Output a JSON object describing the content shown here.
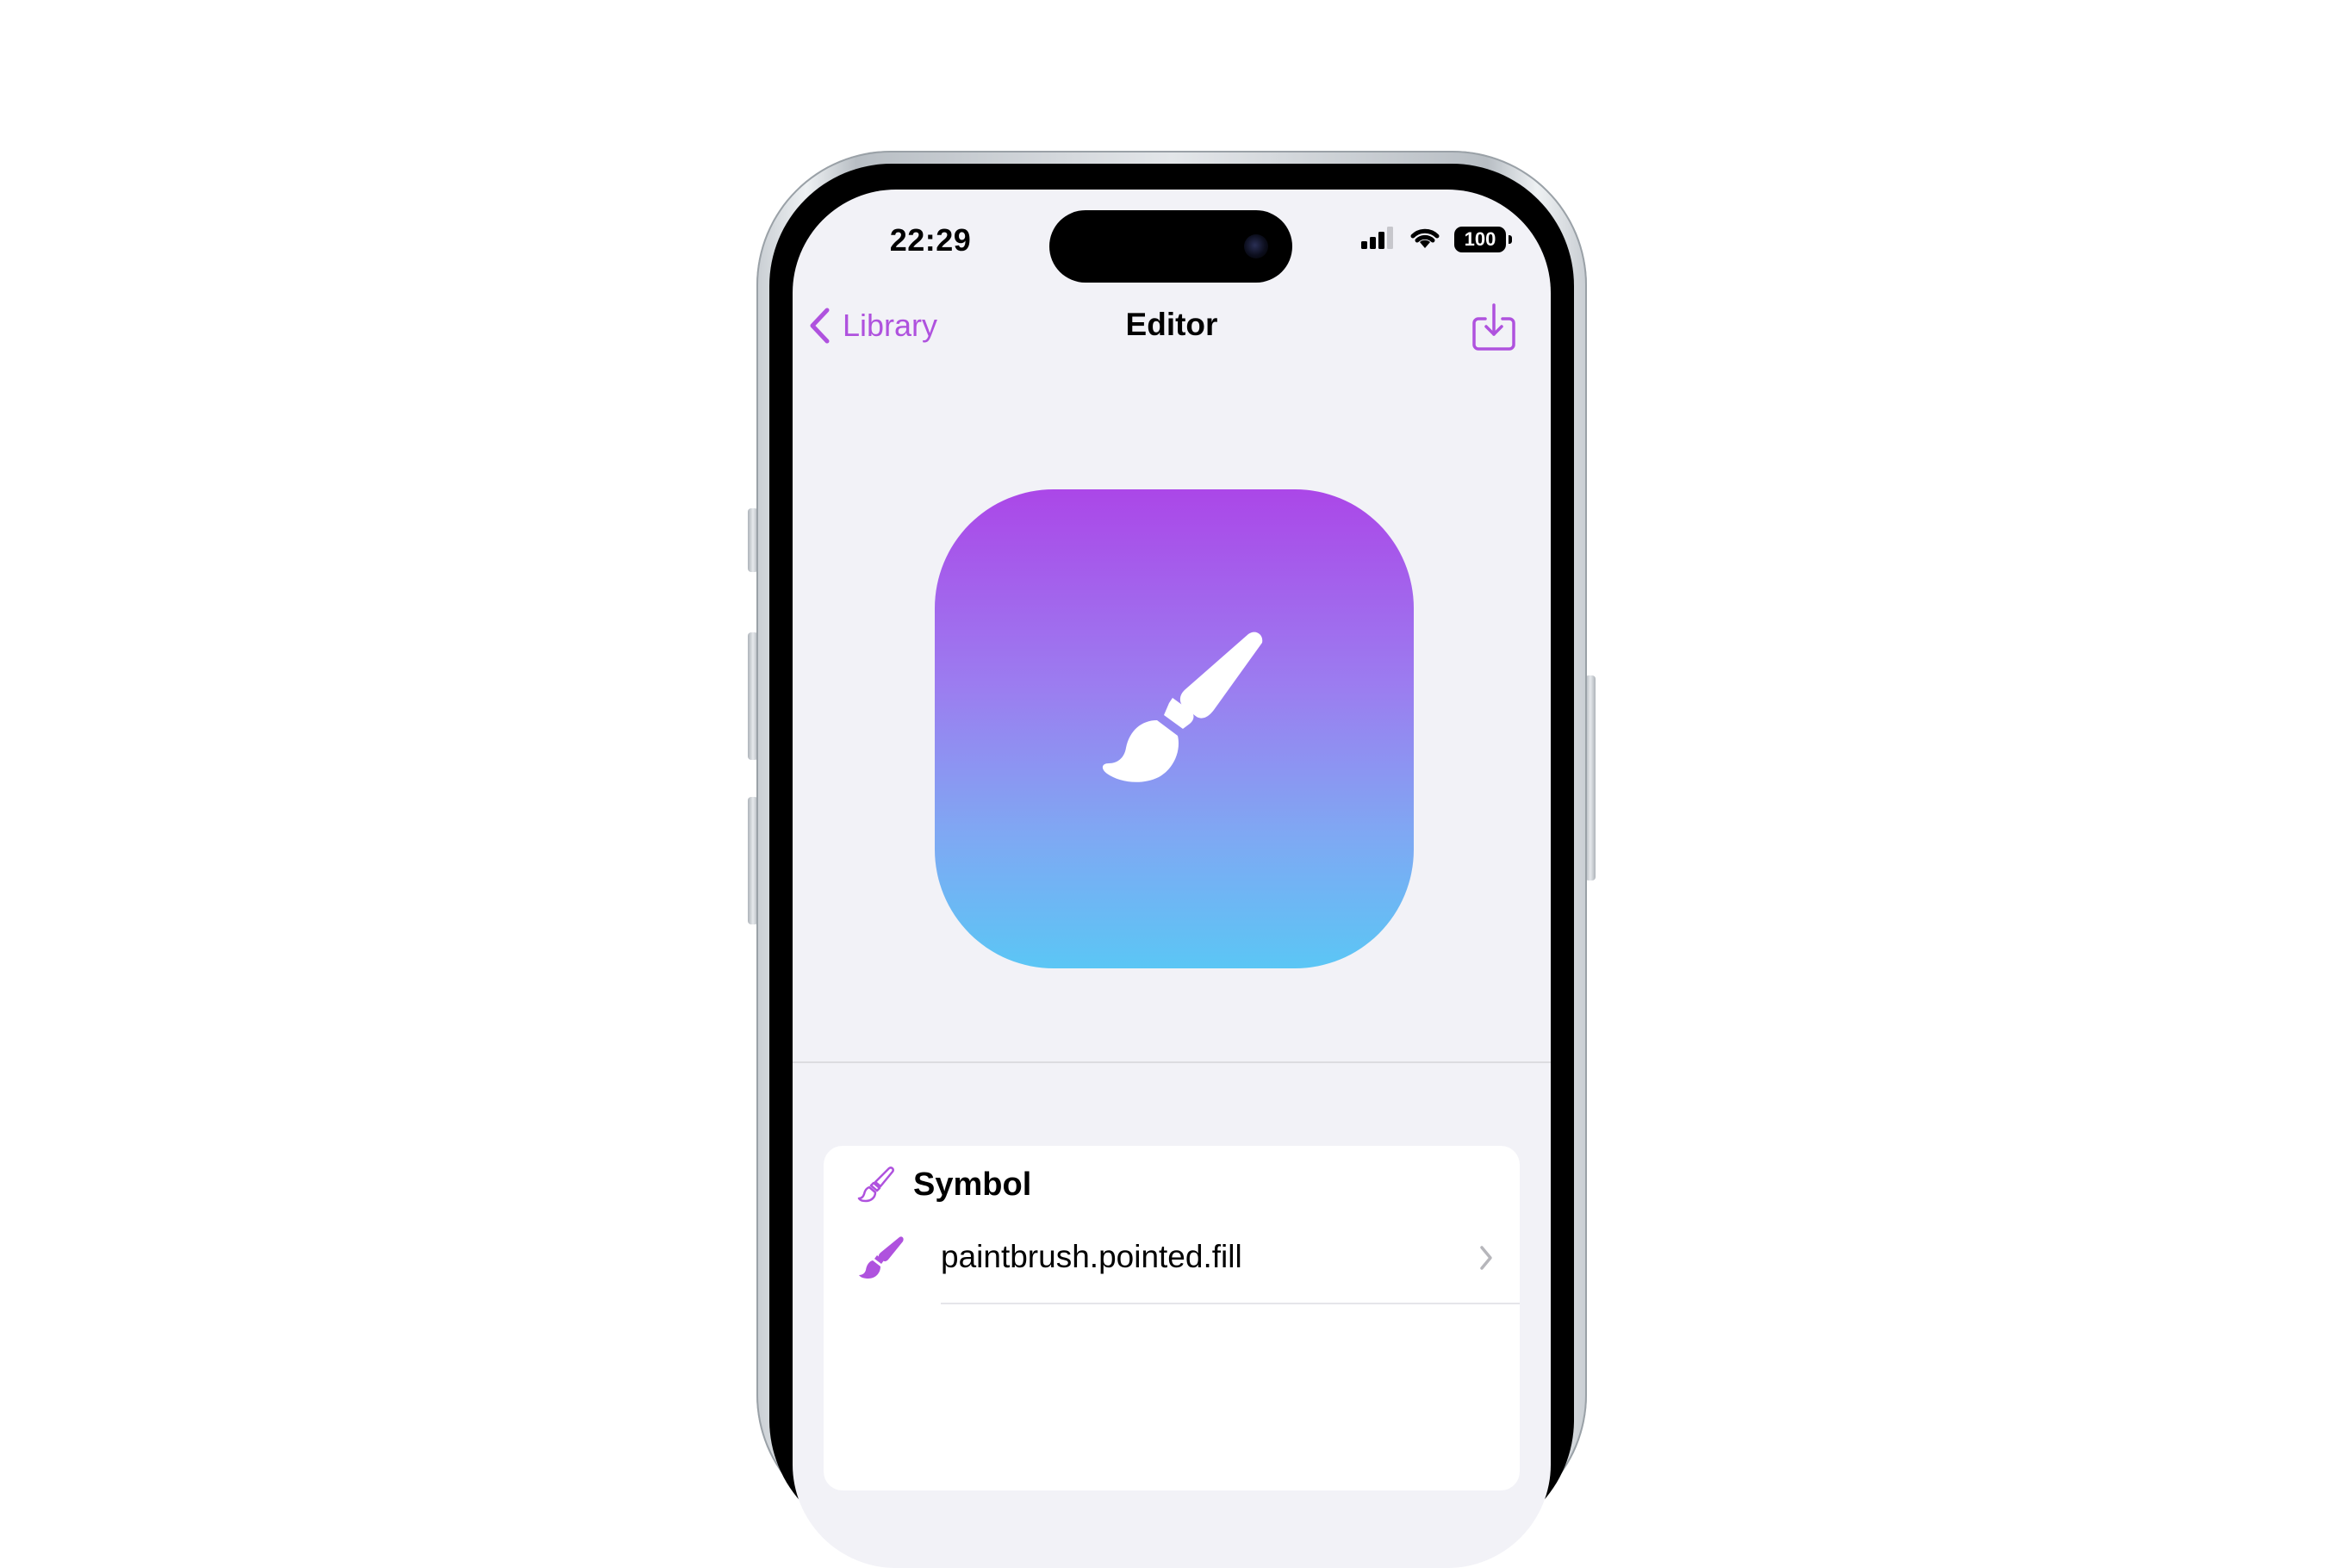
{
  "colors": {
    "accent": "#af52de",
    "screen_bg": "#f2f2f7",
    "gradient_top": "#ab47e8",
    "gradient_bottom": "#5bc6f5"
  },
  "status_bar": {
    "time": "22:29",
    "battery": "100",
    "icons": [
      "cellular-signal-icon",
      "wifi-icon",
      "battery-icon"
    ]
  },
  "nav": {
    "back_label": "Library",
    "title": "Editor",
    "action_icon": "square-and-arrow-down-icon"
  },
  "preview": {
    "symbol_icon": "paintbrush-pointed-fill-icon"
  },
  "symbol_section": {
    "header_label": "Symbol",
    "header_icon": "paintbrush-pointed-icon",
    "selected_value": "paintbrush.pointed.fill",
    "row_icon": "paintbrush-pointed-fill-icon"
  }
}
